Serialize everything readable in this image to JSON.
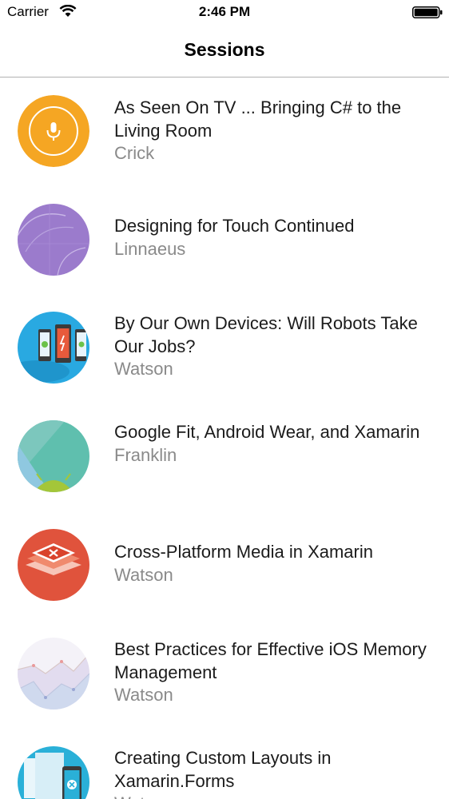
{
  "status_bar": {
    "carrier": "Carrier",
    "time": "2:46 PM",
    "wifi_icon": "wifi-icon",
    "battery_icon": "battery-full-icon"
  },
  "nav": {
    "title": "Sessions"
  },
  "sessions": [
    {
      "title": "As Seen On TV ... Bringing C# to the Living Room",
      "speaker": "Crick",
      "thumbnail_icon": "microphone-icon",
      "color": "#f5a623"
    },
    {
      "title": "Designing for Touch Continued",
      "speaker": "Linnaeus",
      "thumbnail_icon": "purple-abstract-thumbnail",
      "color": "#9b7bcc"
    },
    {
      "title": "By Our Own Devices: Will Robots Take Our Jobs?",
      "speaker": "Watson",
      "thumbnail_icon": "phones-thumbnail",
      "color": "#29a9e1"
    },
    {
      "title": "Google Fit, Android Wear, and Xamarin",
      "speaker": "Franklin",
      "thumbnail_icon": "android-thumbnail",
      "color": "#5fbfae"
    },
    {
      "title": "Cross-Platform Media in Xamarin",
      "speaker": "Watson",
      "thumbnail_icon": "xamarin-layers-thumbnail",
      "color": "#e0533c"
    },
    {
      "title": "Best Practices for Effective iOS Memory Management",
      "speaker": "Watson",
      "thumbnail_icon": "memory-graph-thumbnail",
      "color": "#e8e4f2"
    },
    {
      "title": "Creating Custom Layouts in Xamarin.Forms",
      "speaker": "Watson",
      "thumbnail_icon": "custom-layouts-thumbnail",
      "color": "#2ab0d8"
    }
  ]
}
